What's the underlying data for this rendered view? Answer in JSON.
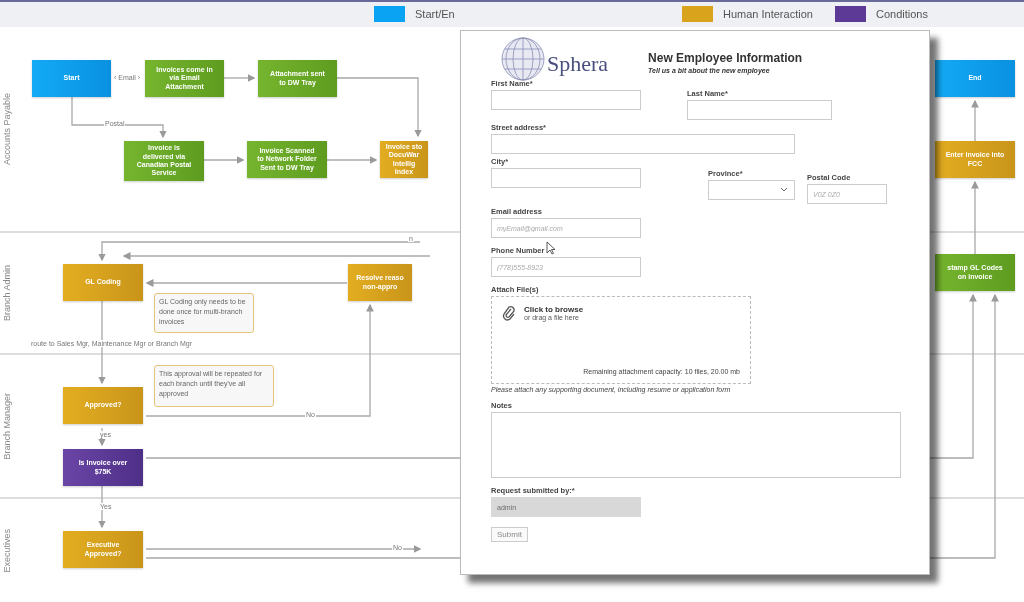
{
  "legend": [
    {
      "label": "Start/En",
      "color": "#0aa2f2"
    },
    {
      "label": "Human Interaction",
      "color": "#d9a41c"
    },
    {
      "label": "Conditions",
      "color": "#5c3a96"
    }
  ],
  "lanes": [
    {
      "label": "Accounts Payable"
    },
    {
      "label": "Branch Admin"
    },
    {
      "label": "Branch Manager"
    },
    {
      "label": "Executives"
    }
  ],
  "nodes": [
    {
      "kind": "terminal",
      "lines": [
        "Start"
      ]
    },
    {
      "kind": "process",
      "lines": [
        "Invoices come in",
        "via Email",
        "Attachment"
      ]
    },
    {
      "kind": "process",
      "lines": [
        "Attachment sent",
        "to DW Tray"
      ]
    },
    {
      "kind": "process",
      "lines": [
        "Invoice is",
        "delivered via",
        "Canadian Postal",
        "Service"
      ]
    },
    {
      "kind": "process",
      "lines": [
        "Invoice Scanned",
        "to Network Folder",
        "Sent to DW Tray"
      ]
    },
    {
      "kind": "human",
      "lines": [
        "Invoice sto",
        "DocuWar",
        "Intellig",
        "Index"
      ]
    },
    {
      "kind": "terminal",
      "lines": [
        "End"
      ]
    },
    {
      "kind": "human",
      "lines": [
        "Enter invoice into",
        "FCC"
      ]
    },
    {
      "kind": "process",
      "lines": [
        "stamp GL Codes",
        "on invoice"
      ]
    },
    {
      "kind": "human",
      "lines": [
        "GL Coding"
      ]
    },
    {
      "kind": "human",
      "lines": [
        "Resolve reaso",
        "non-appro"
      ]
    },
    {
      "kind": "human",
      "lines": [
        "Approved?"
      ]
    },
    {
      "kind": "condition",
      "lines": [
        "Is Invoice over",
        "$75K"
      ]
    },
    {
      "kind": "human",
      "lines": [
        "Executive",
        "Approved?"
      ]
    }
  ],
  "notes": [
    "GL Coding only needs to be done once for multi-branch invoices",
    "This approval will be repeated for each branch until they've all approved"
  ],
  "edge_labels": [
    "‹ Email ›",
    "Postal",
    "n",
    "route to Sales Mgr, Maintenance Mgr or Branch Mgr",
    "No",
    "yes",
    "Yes",
    "No"
  ],
  "form": {
    "logo": "Sphera",
    "title": "New Employee Information",
    "subtitle": "Tell us a bit about the new employee",
    "fields": [
      {
        "kind": "text",
        "label": "First Name*"
      },
      {
        "kind": "text",
        "label": "Last Name*"
      },
      {
        "kind": "text",
        "label": "Street address*"
      },
      {
        "kind": "text",
        "label": "City*"
      },
      {
        "kind": "select",
        "label": "Province*"
      },
      {
        "kind": "text",
        "label": "Postal Code",
        "placeholder": "V0Z 0Z0"
      },
      {
        "kind": "text",
        "label": "Email address",
        "placeholder": "myEmail@gmail.com"
      },
      {
        "kind": "text",
        "label": "Phone Number",
        "placeholder": "(778)555-8923"
      }
    ],
    "attach": {
      "label": "Attach File(s)",
      "browse": "Click to browse",
      "drag": "or drag a file here",
      "capacity": "Remaining attachment capacity: 10 files, 20.00 mb",
      "help": "Please attach any supporting document, including resume or application form"
    },
    "notes_label": "Notes",
    "submitted": {
      "label": "Request submitted by:*",
      "placeholder": "admin",
      "disabled": true
    },
    "submit": "Submit"
  }
}
